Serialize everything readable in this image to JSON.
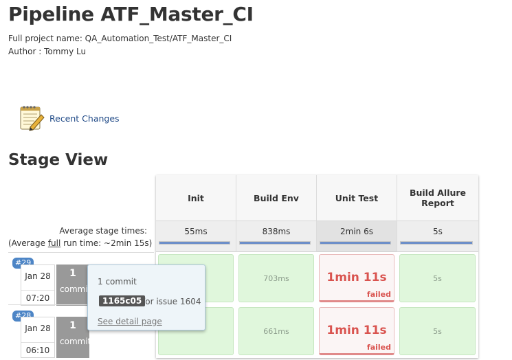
{
  "page": {
    "title": "Pipeline ATF_Master_CI",
    "full_project_name": "Full project name: QA_Automation_Test/ATF_Master_CI",
    "author": "Author : Tommy Lu"
  },
  "recent_changes": {
    "label": "Recent Changes",
    "icon": "notepad-pencil-icon"
  },
  "stage_view": {
    "title": "Stage View",
    "avg_stage_times_label": "Average stage times:",
    "avg_run_prefix": "(Average ",
    "avg_run_link": "full",
    "avg_run_suffix": " run time: ~2min 15s)",
    "stages": [
      {
        "name": "Init",
        "avg": "55ms",
        "progress": 1.0
      },
      {
        "name": "Build Env",
        "avg": "838ms",
        "progress": 1.0
      },
      {
        "name": "Unit Test",
        "avg": "2min 6s",
        "progress": 1.0
      },
      {
        "name": "Build Allure Report",
        "avg": "5s",
        "progress": 1.0
      }
    ],
    "runs": [
      {
        "id": "#29",
        "date": "Jan 28",
        "time": "07:20",
        "commits_count": "1",
        "commits_word": "commit",
        "cells": [
          {
            "value": "",
            "status": "success"
          },
          {
            "value": "703ms",
            "status": "success"
          },
          {
            "value": "1min 11s",
            "status": "failed",
            "status_label": "failed"
          },
          {
            "value": "5s",
            "status": "success"
          }
        ]
      },
      {
        "id": "#28",
        "date": "Jan 28",
        "time": "06:10",
        "commits_count": "1",
        "commits_word": "commit",
        "cells": [
          {
            "value": "",
            "status": "success"
          },
          {
            "value": "661ms",
            "status": "success"
          },
          {
            "value": "1min 11s",
            "status": "failed",
            "status_label": "failed"
          },
          {
            "value": "5s",
            "status": "success"
          }
        ]
      }
    ]
  },
  "popup": {
    "commit_count": "1 commit",
    "sha": "1165c05",
    "issue_text": "for issue 1604",
    "detail_link": "See detail page"
  },
  "colors": {
    "success": "#e0f7dc",
    "failed": "#d9534f",
    "badge": "#4d85c6",
    "link": "#204a87"
  }
}
